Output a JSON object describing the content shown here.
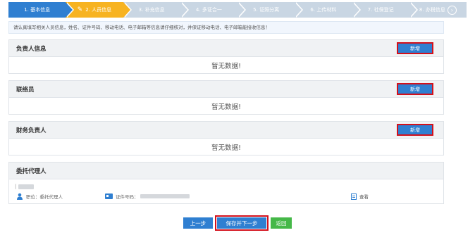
{
  "steps": [
    {
      "label": "1. 基本信息",
      "state": "done"
    },
    {
      "label": "2. 人员信息",
      "state": "active"
    },
    {
      "label": "3. 补充信息",
      "state": "todo"
    },
    {
      "label": "4. 多证合一",
      "state": "todo"
    },
    {
      "label": "5. 证照分离",
      "state": "todo"
    },
    {
      "label": "6. 上传材料",
      "state": "todo"
    },
    {
      "label": "7. 社保登记",
      "state": "todo"
    },
    {
      "label": "8. 办税信息",
      "state": "todo"
    }
  ],
  "notice": "请认真填写相关人员信息，姓名、证件号码、移动电话、电子邮箱等信息请仔细核对，并保证移动电话、电子邮箱能接收信息！",
  "sections": {
    "responsible": {
      "title": "负责人信息",
      "add_label": "新增",
      "empty_text": "暂无数据!"
    },
    "contact": {
      "title": "联络员",
      "add_label": "新增",
      "empty_text": "暂无数据!"
    },
    "finance": {
      "title": "财务负责人",
      "add_label": "新增",
      "empty_text": "暂无数据!"
    },
    "agent": {
      "title": "委托代理人",
      "position_label": "职位：",
      "position_value": "委托代理人",
      "id_label": "证件号码：",
      "view_label": "查看"
    }
  },
  "buttons": {
    "prev": "上一步",
    "save_next": "保存并下一步",
    "back": "返回"
  },
  "colors": {
    "primary": "#2f7fd1",
    "active_step": "#f7b321",
    "highlight": "#d3101b",
    "back_button": "#45b848"
  }
}
